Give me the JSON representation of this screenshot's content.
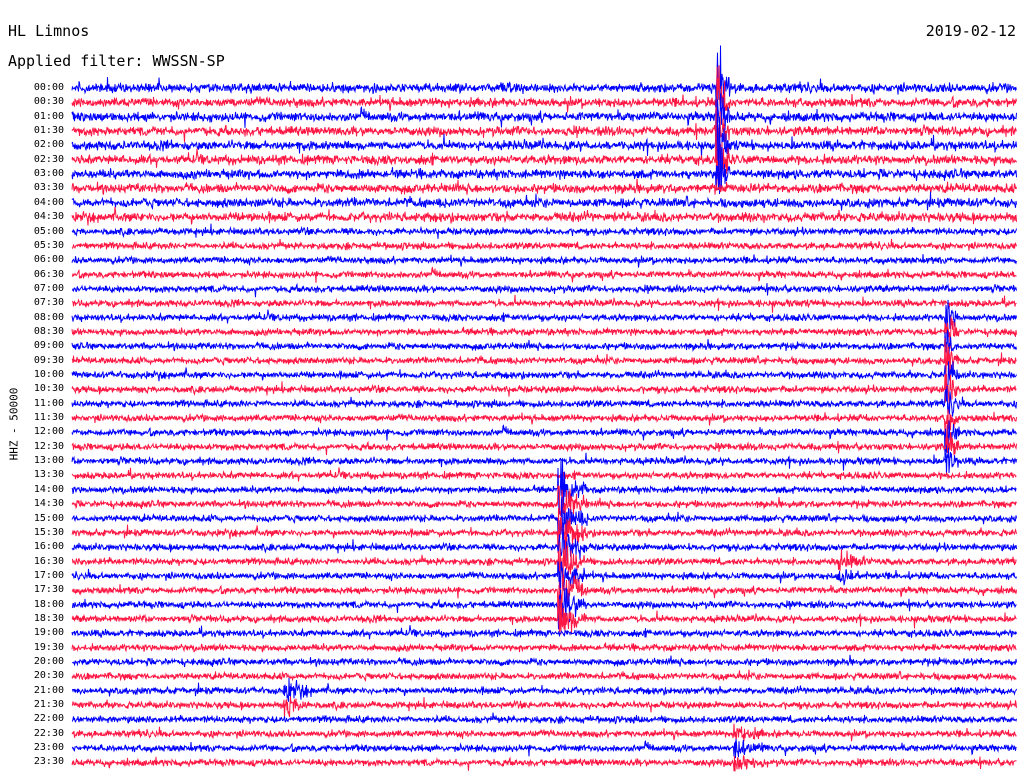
{
  "header": {
    "station": "HL Limnos",
    "date": "2019-02-12",
    "filter": "Applied filter: WWSSN-SP"
  },
  "chart_data": {
    "type": "line",
    "title": "HL Limnos",
    "subtitle": "Applied filter: WWSSN-SP",
    "date": "2019-02-12",
    "ylabel": "HHZ - 50000",
    "xlabel": "",
    "tick_labels": [
      "00:00",
      "00:30",
      "01:00",
      "01:30",
      "02:00",
      "02:30",
      "03:00",
      "03:30",
      "04:00",
      "04:30",
      "05:00",
      "05:30",
      "06:00",
      "06:30",
      "07:00",
      "07:30",
      "08:00",
      "08:30",
      "09:00",
      "09:30",
      "10:00",
      "10:30",
      "11:00",
      "11:30",
      "12:00",
      "12:30",
      "13:00",
      "13:30",
      "14:00",
      "14:30",
      "15:00",
      "15:30",
      "16:00",
      "16:30",
      "17:00",
      "17:30",
      "18:00",
      "18:30",
      "19:00",
      "19:30",
      "20:00",
      "20:30",
      "21:00",
      "21:30",
      "22:00",
      "22:30",
      "23:00",
      "23:30"
    ],
    "trace_colors": [
      "#0000ff",
      "#ff1744"
    ],
    "grid": false,
    "legend": "none",
    "events": [
      {
        "description": "large event",
        "trace_from": "00:00",
        "trace_to": "03:00",
        "minute": 20.5
      },
      {
        "description": "strong event",
        "trace_from": "14:00",
        "trace_to": "18:30",
        "minute": 15.5
      },
      {
        "description": "late event",
        "trace_from": "08:00",
        "trace_to": "13:00",
        "minute": 27.8
      },
      {
        "description": "small event",
        "trace_from": "21:00",
        "trace_to": "21:30",
        "minute": 6.8
      },
      {
        "description": "small event",
        "trace_from": "22:30",
        "trace_to": "23:30",
        "minute": 21.1
      },
      {
        "description": "small event",
        "trace_from": "16:30",
        "trace_to": "17:00",
        "minute": 24.4
      }
    ]
  }
}
